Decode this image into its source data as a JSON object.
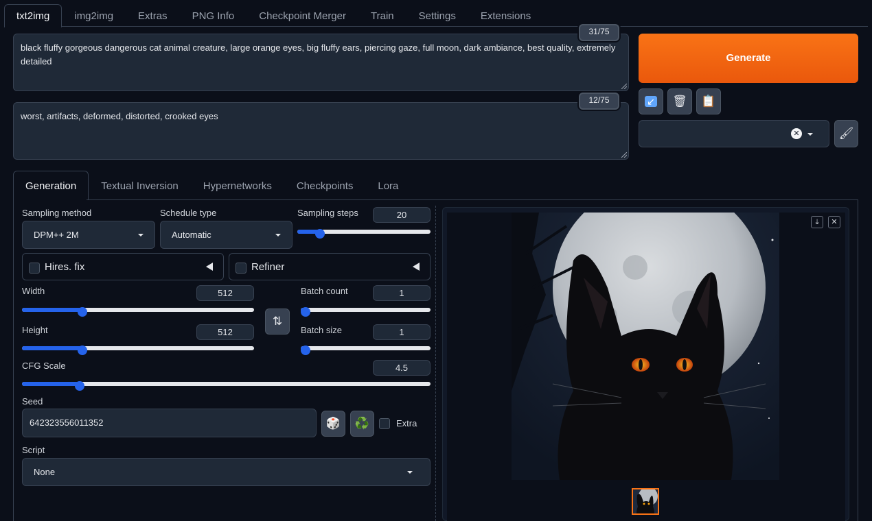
{
  "top_tabs": [
    "txt2img",
    "img2img",
    "Extras",
    "PNG Info",
    "Checkpoint Merger",
    "Train",
    "Settings",
    "Extensions"
  ],
  "prompt": {
    "text": "black fluffy gorgeous dangerous cat animal creature, large orange eyes, big fluffy ears, piercing gaze, full moon, dark ambiance, best quality, extremely detailed",
    "token_count": "31/75"
  },
  "negative_prompt": {
    "text": "worst, artifacts, deformed, distorted, crooked eyes",
    "token_count": "12/75"
  },
  "actions": {
    "generate_label": "Generate",
    "tool_icons": [
      "↙",
      "🗑",
      "📋"
    ],
    "style_clear_icon": "✕",
    "brush_icon": "🖌"
  },
  "sub_tabs": [
    "Generation",
    "Textual Inversion",
    "Hypernetworks",
    "Checkpoints",
    "Lora"
  ],
  "generation": {
    "sampling_method_label": "Sampling method",
    "sampling_method_value": "DPM++ 2M",
    "schedule_type_label": "Schedule type",
    "schedule_type_value": "Automatic",
    "sampling_steps_label": "Sampling steps",
    "sampling_steps_value": "20",
    "hires_fix_label": "Hires. fix",
    "refiner_label": "Refiner",
    "width_label": "Width",
    "width_value": "512",
    "height_label": "Height",
    "height_value": "512",
    "swap_icon": "⇅",
    "batch_count_label": "Batch count",
    "batch_count_value": "1",
    "batch_size_label": "Batch size",
    "batch_size_value": "1",
    "cfg_scale_label": "CFG Scale",
    "cfg_scale_value": "4.5",
    "seed_label": "Seed",
    "seed_value": "642323556011352",
    "dice_icon": "🎲",
    "recycle_icon": "♻️",
    "extra_label": "Extra",
    "script_label": "Script",
    "script_value": "None"
  },
  "sliders": {
    "sampling_steps": 0.135,
    "width": 0.24,
    "height": 0.24,
    "batch_count": 0.0,
    "batch_size": 0.0,
    "cfg_scale": 0.13
  },
  "output": {
    "download_icon": "⤓",
    "close_icon": "✕"
  },
  "colors": {
    "accent": "#f97316",
    "slider": "#2563eb",
    "background": "#0b0f19"
  }
}
